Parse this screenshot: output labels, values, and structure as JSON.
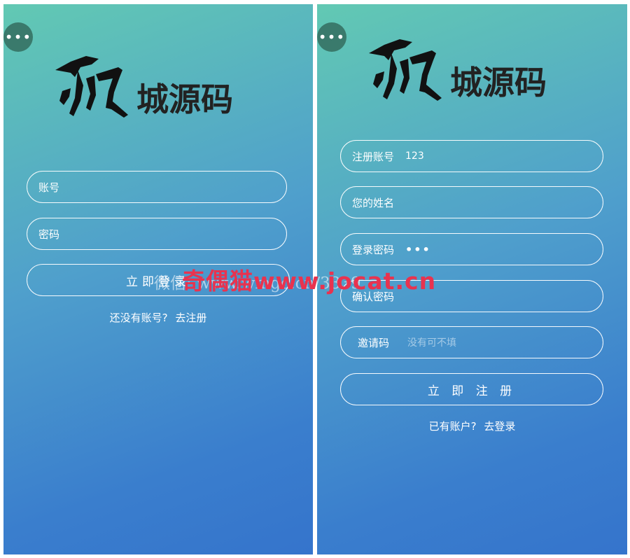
{
  "menu_icon": "more-dots-icon",
  "logo_text": "乐贝城源码",
  "login": {
    "account_placeholder": "账号",
    "password_placeholder": "密码",
    "submit_label": "立即登录",
    "no_account_text": "还没有账号?",
    "register_link": "去注册"
  },
  "register": {
    "account_label": "注册账号",
    "account_value": "123",
    "name_label": "您的姓名",
    "password_label": "登录密码",
    "password_value": "•••",
    "confirm_label": "确认密码",
    "invite_label": "邀请码",
    "invite_placeholder": "没有可不填",
    "submit_label": "立 即 注 册",
    "has_account_text": "已有账户?",
    "login_link": "去登录"
  },
  "watermark": {
    "red_text": "奇偶猫www.jocat.cn",
    "faint_text": "微信: www.wmgo.cn/3339"
  },
  "colors": {
    "gradient_top": "#62c9b3",
    "gradient_bottom": "#3574cc",
    "menu_button": "#3a7a6c",
    "watermark_red": "#e8334f"
  }
}
